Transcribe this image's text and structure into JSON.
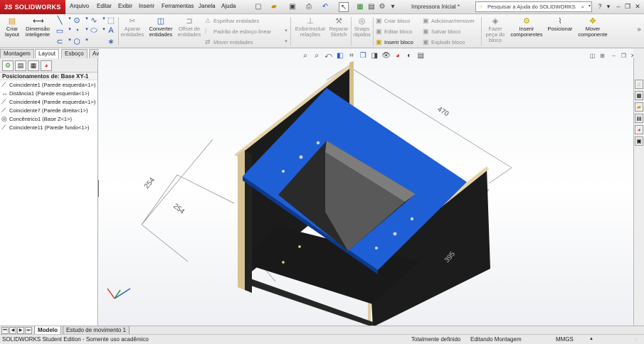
{
  "app": {
    "brand_prefix": "3S",
    "brand_name": "SOLIDWORKS",
    "document_title": "Impressora Inicial *"
  },
  "menu": [
    "Arquivo",
    "Editar",
    "Exibir",
    "Inserir",
    "Ferramentas",
    "Janela",
    "Ajuda"
  ],
  "help_search": {
    "placeholder": "Pesquisar a Ajuda do SOLIDWORKS"
  },
  "command_manager": {
    "criar_layout": "Criar layout",
    "dimensao_inteligente": "Dimensão inteligente",
    "aparar_entidades": "Aparar entidades",
    "converter_entidades": "Converter entidades",
    "offset_entidades": "Offset de entidades",
    "espelhar_entidades": "Espelhar entidades",
    "padrao_esboco_linear": "Padrão de esboço linear",
    "mover_entidades": "Mover entidades",
    "exibir_excluir_relacoes": "Exibir/excluir relações",
    "reparar_sketch": "Reparar Sketch",
    "snaps_rapidos": "Snaps rápidos",
    "criar_bloco": "Criar bloco",
    "editar_bloco": "Editar bloco",
    "inserir_bloco": "Inserir bloco",
    "adicionar_remover": "Adicionar/remover",
    "salvar_bloco": "Salvar bloco",
    "explodir_bloco": "Explodir bloco",
    "fazer_peca_do_bloco": "Fazer peça do bloco",
    "inserir_componentes": "Inserir componentes",
    "posicionar": "Posicionar",
    "mover_componente": "Mover componente"
  },
  "tabs": [
    "Montagem",
    "Layout",
    "Esboço",
    "Avaliar"
  ],
  "active_tab": "Layout",
  "tree": {
    "header": "Posicionamentos de: Base XY-1",
    "items": [
      {
        "icon": "coincident-icon",
        "label": "Coincidente1 (Parede esquerda<1>)"
      },
      {
        "icon": "distance-icon",
        "label": "Distância1 (Parede esquerda<1>)"
      },
      {
        "icon": "coincident-icon",
        "label": "Coincidente4 (Parede esquerda<1>)"
      },
      {
        "icon": "coincident-icon",
        "label": "Coincidente7 (Parede direita<1>)"
      },
      {
        "icon": "concentric-icon",
        "label": "Concêntrico1 (Base Z<1>)"
      },
      {
        "icon": "coincident-icon",
        "label": "Coincidente11 (Parede fundo<1>)"
      }
    ]
  },
  "dimensions": {
    "top_depth": "470",
    "left_upper": "254",
    "left_lower": "254",
    "front_width": "395"
  },
  "bottom_tabs": [
    "Modelo",
    "Estudo de movimento 1"
  ],
  "active_bottom_tab": "Modelo",
  "status": {
    "edition": "SOLIDWORKS Student Edition - Somente uso acadêmico",
    "definition": "Totalmente definido",
    "mode": "Editando Montagem",
    "units": "MMGS"
  },
  "colors": {
    "accent_red": "#c41e24",
    "blue_plate": "#1f5fd6",
    "wall": "#1c1c1c",
    "wood_edge": "#e3cfa6"
  }
}
